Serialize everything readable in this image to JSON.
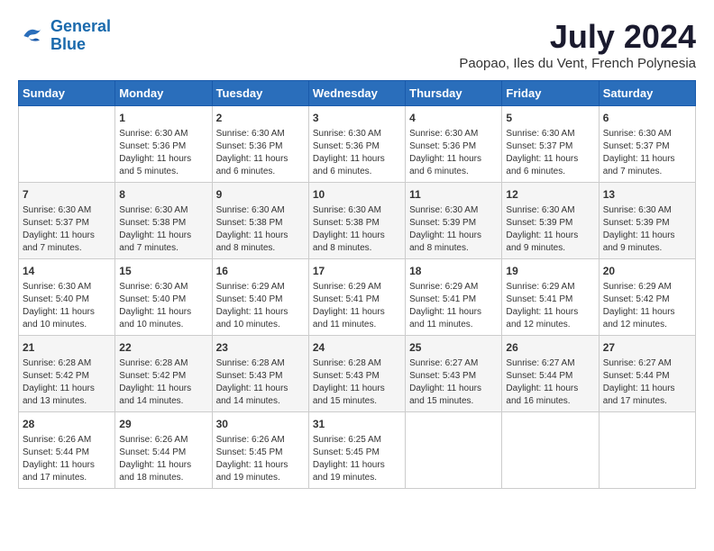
{
  "logo": {
    "line1": "General",
    "line2": "Blue"
  },
  "title": "July 2024",
  "location": "Paopao, Iles du Vent, French Polynesia",
  "headers": [
    "Sunday",
    "Monday",
    "Tuesday",
    "Wednesday",
    "Thursday",
    "Friday",
    "Saturday"
  ],
  "weeks": [
    [
      {
        "day": "",
        "info": ""
      },
      {
        "day": "1",
        "info": "Sunrise: 6:30 AM\nSunset: 5:36 PM\nDaylight: 11 hours\nand 5 minutes."
      },
      {
        "day": "2",
        "info": "Sunrise: 6:30 AM\nSunset: 5:36 PM\nDaylight: 11 hours\nand 6 minutes."
      },
      {
        "day": "3",
        "info": "Sunrise: 6:30 AM\nSunset: 5:36 PM\nDaylight: 11 hours\nand 6 minutes."
      },
      {
        "day": "4",
        "info": "Sunrise: 6:30 AM\nSunset: 5:36 PM\nDaylight: 11 hours\nand 6 minutes."
      },
      {
        "day": "5",
        "info": "Sunrise: 6:30 AM\nSunset: 5:37 PM\nDaylight: 11 hours\nand 6 minutes."
      },
      {
        "day": "6",
        "info": "Sunrise: 6:30 AM\nSunset: 5:37 PM\nDaylight: 11 hours\nand 7 minutes."
      }
    ],
    [
      {
        "day": "7",
        "info": "Sunrise: 6:30 AM\nSunset: 5:37 PM\nDaylight: 11 hours\nand 7 minutes."
      },
      {
        "day": "8",
        "info": "Sunrise: 6:30 AM\nSunset: 5:38 PM\nDaylight: 11 hours\nand 7 minutes."
      },
      {
        "day": "9",
        "info": "Sunrise: 6:30 AM\nSunset: 5:38 PM\nDaylight: 11 hours\nand 8 minutes."
      },
      {
        "day": "10",
        "info": "Sunrise: 6:30 AM\nSunset: 5:38 PM\nDaylight: 11 hours\nand 8 minutes."
      },
      {
        "day": "11",
        "info": "Sunrise: 6:30 AM\nSunset: 5:39 PM\nDaylight: 11 hours\nand 8 minutes."
      },
      {
        "day": "12",
        "info": "Sunrise: 6:30 AM\nSunset: 5:39 PM\nDaylight: 11 hours\nand 9 minutes."
      },
      {
        "day": "13",
        "info": "Sunrise: 6:30 AM\nSunset: 5:39 PM\nDaylight: 11 hours\nand 9 minutes."
      }
    ],
    [
      {
        "day": "14",
        "info": "Sunrise: 6:30 AM\nSunset: 5:40 PM\nDaylight: 11 hours\nand 10 minutes."
      },
      {
        "day": "15",
        "info": "Sunrise: 6:30 AM\nSunset: 5:40 PM\nDaylight: 11 hours\nand 10 minutes."
      },
      {
        "day": "16",
        "info": "Sunrise: 6:29 AM\nSunset: 5:40 PM\nDaylight: 11 hours\nand 10 minutes."
      },
      {
        "day": "17",
        "info": "Sunrise: 6:29 AM\nSunset: 5:41 PM\nDaylight: 11 hours\nand 11 minutes."
      },
      {
        "day": "18",
        "info": "Sunrise: 6:29 AM\nSunset: 5:41 PM\nDaylight: 11 hours\nand 11 minutes."
      },
      {
        "day": "19",
        "info": "Sunrise: 6:29 AM\nSunset: 5:41 PM\nDaylight: 11 hours\nand 12 minutes."
      },
      {
        "day": "20",
        "info": "Sunrise: 6:29 AM\nSunset: 5:42 PM\nDaylight: 11 hours\nand 12 minutes."
      }
    ],
    [
      {
        "day": "21",
        "info": "Sunrise: 6:28 AM\nSunset: 5:42 PM\nDaylight: 11 hours\nand 13 minutes."
      },
      {
        "day": "22",
        "info": "Sunrise: 6:28 AM\nSunset: 5:42 PM\nDaylight: 11 hours\nand 14 minutes."
      },
      {
        "day": "23",
        "info": "Sunrise: 6:28 AM\nSunset: 5:43 PM\nDaylight: 11 hours\nand 14 minutes."
      },
      {
        "day": "24",
        "info": "Sunrise: 6:28 AM\nSunset: 5:43 PM\nDaylight: 11 hours\nand 15 minutes."
      },
      {
        "day": "25",
        "info": "Sunrise: 6:27 AM\nSunset: 5:43 PM\nDaylight: 11 hours\nand 15 minutes."
      },
      {
        "day": "26",
        "info": "Sunrise: 6:27 AM\nSunset: 5:44 PM\nDaylight: 11 hours\nand 16 minutes."
      },
      {
        "day": "27",
        "info": "Sunrise: 6:27 AM\nSunset: 5:44 PM\nDaylight: 11 hours\nand 17 minutes."
      }
    ],
    [
      {
        "day": "28",
        "info": "Sunrise: 6:26 AM\nSunset: 5:44 PM\nDaylight: 11 hours\nand 17 minutes."
      },
      {
        "day": "29",
        "info": "Sunrise: 6:26 AM\nSunset: 5:44 PM\nDaylight: 11 hours\nand 18 minutes."
      },
      {
        "day": "30",
        "info": "Sunrise: 6:26 AM\nSunset: 5:45 PM\nDaylight: 11 hours\nand 19 minutes."
      },
      {
        "day": "31",
        "info": "Sunrise: 6:25 AM\nSunset: 5:45 PM\nDaylight: 11 hours\nand 19 minutes."
      },
      {
        "day": "",
        "info": ""
      },
      {
        "day": "",
        "info": ""
      },
      {
        "day": "",
        "info": ""
      }
    ]
  ]
}
